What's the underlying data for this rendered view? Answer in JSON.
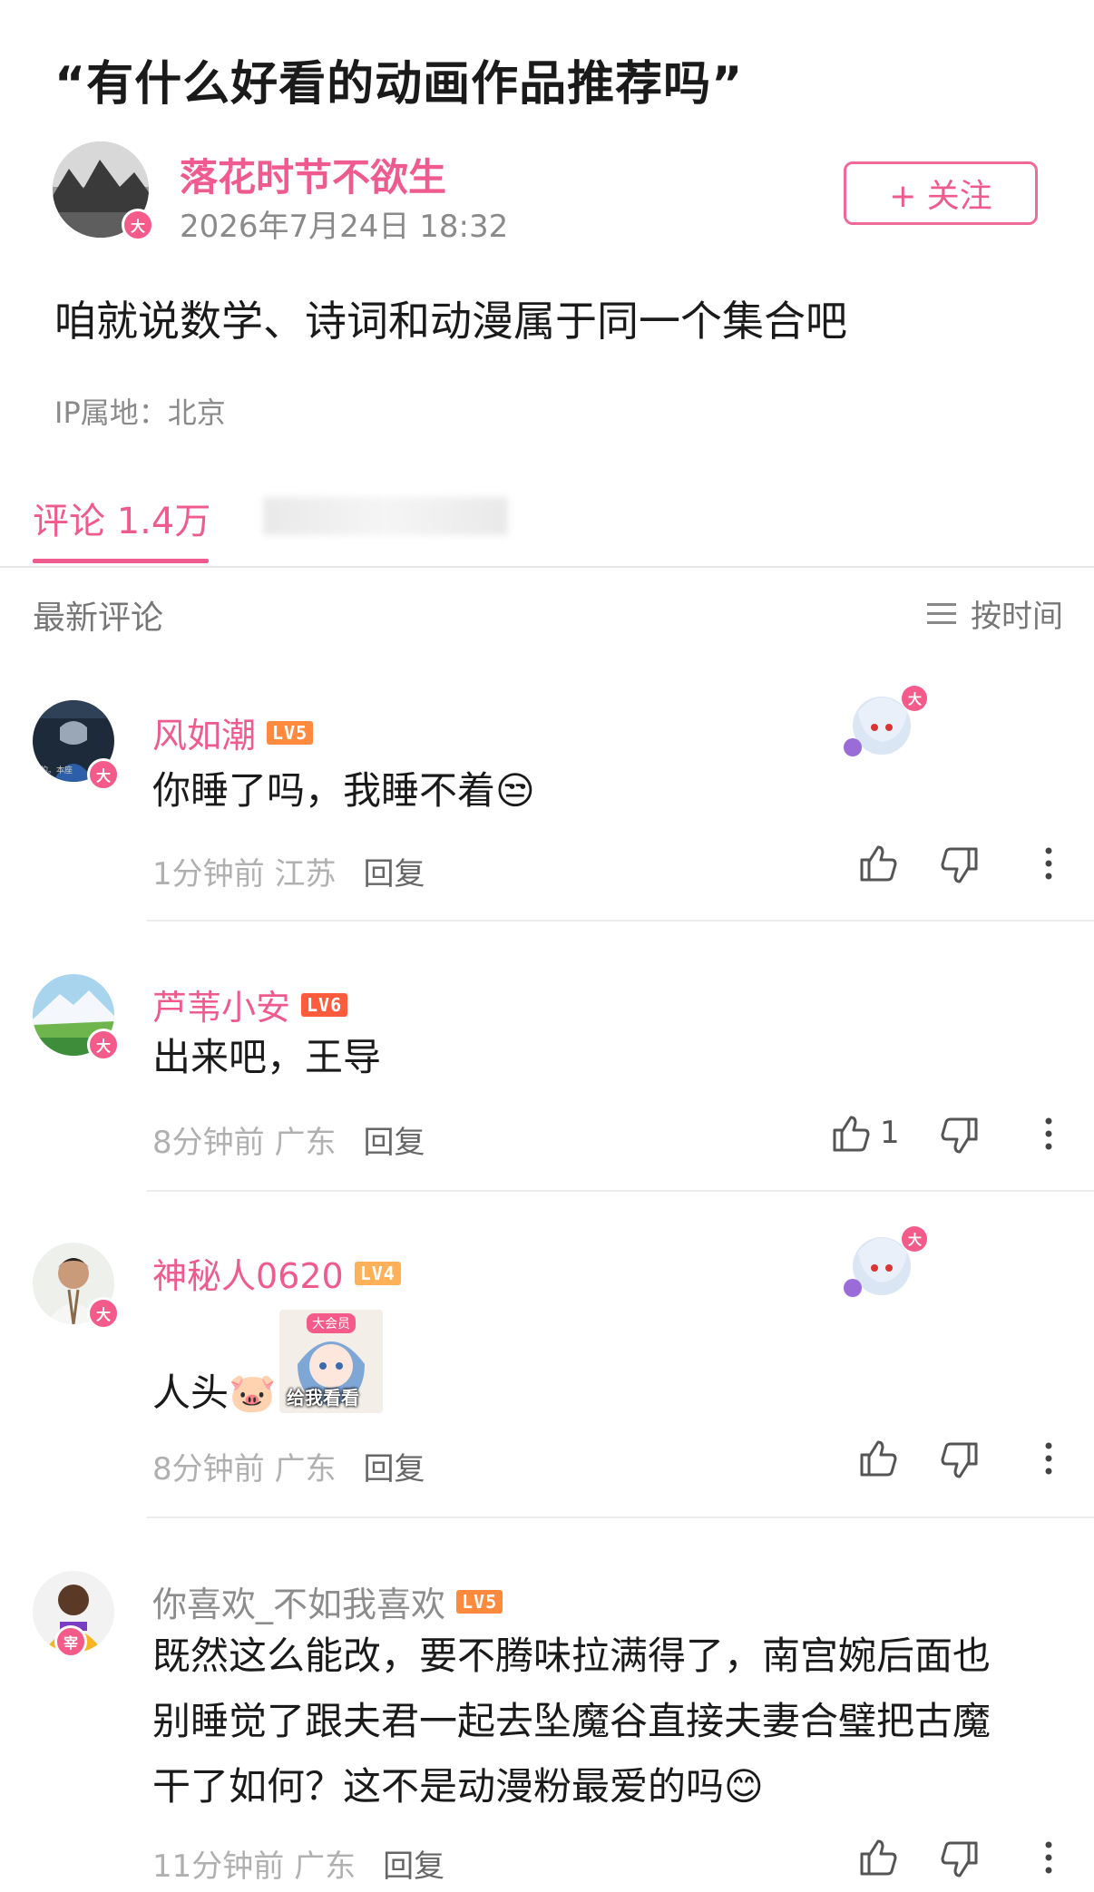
{
  "post": {
    "title": "“有什么好看的动画作品推荐吗”",
    "author": "落花时节不欲生",
    "time": "2026年7月24日 18:32",
    "follow_label": "+ 关注",
    "content": "咱就说数学、诗词和动漫属于同一个集合吧",
    "ip": "IP属地：北京",
    "badge": "大"
  },
  "tabs": {
    "comments_label": "评论 1.4万"
  },
  "list_header": {
    "latest_label": "最新评论",
    "sort_label": "按时间"
  },
  "comments": [
    {
      "user": "风如潮",
      "level": "LV5",
      "text": "你睡了吗，我睡不着",
      "emoji": "😒",
      "time": "1分钟前",
      "location": "江苏",
      "reply": "回复",
      "likes": "",
      "badge": "大"
    },
    {
      "user": "芦苇小安",
      "level": "LV6",
      "text": "出来吧，王导",
      "emoji": "",
      "time": "8分钟前",
      "location": "广东",
      "reply": "回复",
      "likes": "1",
      "badge": "大"
    },
    {
      "user": "神秘人0620",
      "level": "LV4",
      "text": "人头",
      "emoji": "🐷",
      "sticker_tag": "大会员",
      "sticker_caption": "给我看看",
      "time": "8分钟前",
      "location": "广东",
      "reply": "回复",
      "likes": "",
      "badge": "大"
    },
    {
      "user": "你喜欢_不如我喜欢",
      "level": "LV5",
      "text_lines": [
        "既然这么能改，要不腾味拉满得了，南宫婉后面也",
        "别睡觉了跟夫君一起去坠魔谷直接夫妻合璧把古魔",
        "干了如何？这不是动漫粉最爱的吗"
      ],
      "emoji": "😊",
      "time": "11分钟前",
      "location": "广东",
      "reply": "回复",
      "likes": "",
      "badge": "宰"
    }
  ],
  "colors": {
    "accent": "#ef5b8e",
    "lv5": "#ff8a3d",
    "lv6": "#ff5b3d",
    "lv4": "#ffb15a"
  }
}
